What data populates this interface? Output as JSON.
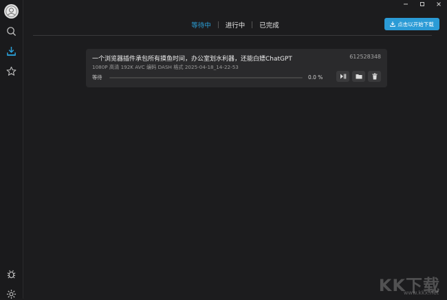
{
  "window": {
    "minimize_icon": "minimize-icon",
    "maximize_icon": "maximize-icon",
    "close_icon": "close-icon"
  },
  "sidebar": {
    "items": [
      {
        "name": "avatar"
      },
      {
        "name": "search-icon"
      },
      {
        "name": "download-icon",
        "active": true
      },
      {
        "name": "star-icon"
      }
    ],
    "bottom": [
      {
        "name": "bug-icon"
      },
      {
        "name": "gear-icon"
      }
    ]
  },
  "tabs": [
    {
      "label": "等待中",
      "active": true
    },
    {
      "label": "进行中",
      "active": false
    },
    {
      "label": "已完成",
      "active": false
    }
  ],
  "download_button": {
    "label": "点击以开始下载",
    "icon": "download-icon"
  },
  "task": {
    "title": "一个浏览器插件承包所有摸鱼时间，办公室划水利器，还能白嫖ChatGPT",
    "id": "612528348",
    "meta": "1080P 高清  192K  AVC 编码  DASH 格式  2025-04-18_14-22-53",
    "status": "等待",
    "progress": 0,
    "progress_label": "0.0 %",
    "actions": [
      {
        "name": "play-pause-icon"
      },
      {
        "name": "folder-icon"
      },
      {
        "name": "trash-icon"
      }
    ]
  },
  "watermark": {
    "logo": "KK下载",
    "url": "www.kkx.net"
  },
  "colors": {
    "accent": "#2aa0d8",
    "background": "#1c1c1e",
    "card": "#2a2a2c"
  }
}
